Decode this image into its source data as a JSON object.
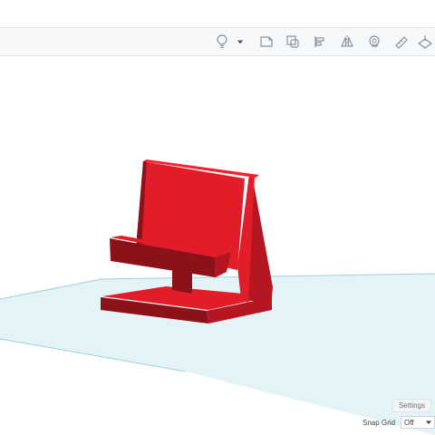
{
  "toolbar": {
    "icons": [
      "lightbulb-icon",
      "dropdown-arrow-icon",
      "note-icon",
      "duplicate-icon",
      "align-icon",
      "mirror-icon",
      "group-icon",
      "ruler-icon",
      "workplane-icon"
    ]
  },
  "viewport": {
    "object_color": "#e11d2a",
    "workplane_color": "#e3f3f7",
    "workplane_edge_color": "#9fd0dc"
  },
  "settings": {
    "label": "Settings"
  },
  "snap_grid": {
    "label": "Snap Grid",
    "value": "Off"
  }
}
